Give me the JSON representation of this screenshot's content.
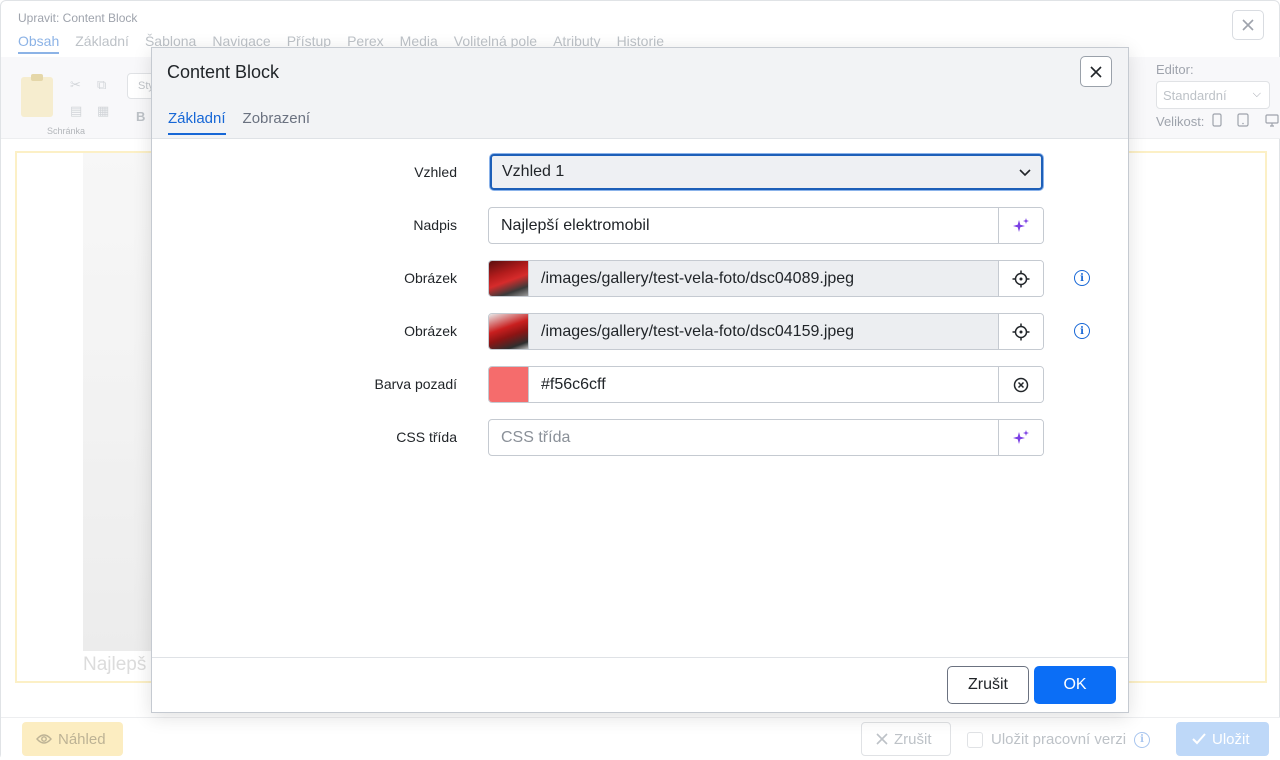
{
  "background": {
    "window_title": "Upravit: Content Block",
    "tabs": [
      "Obsah",
      "Základní",
      "Šablona",
      "Navigace",
      "Přístup",
      "Perex",
      "Media",
      "Volitelná pole",
      "Atributy",
      "Historie"
    ],
    "toolbar": {
      "clipboard_label": "Schránka",
      "style_placeholder": "Sty",
      "bold_label": "B",
      "editor_label": "Editor:",
      "editor_value": "Standardní",
      "size_label": "Velikost:"
    },
    "content_text": "Najlepš",
    "footer": {
      "preview_label": "Náhled",
      "cancel_label": "Zrušit",
      "save_draft_label": "Uložit pracovní verzi",
      "save_label": "Uložit"
    }
  },
  "modal": {
    "title": "Content Block",
    "tabs": [
      {
        "label": "Základní",
        "active": true
      },
      {
        "label": "Zobrazení",
        "active": false
      }
    ],
    "fields": {
      "appearance": {
        "label": "Vzhled",
        "value": "Vzhled 1"
      },
      "heading": {
        "label": "Nadpis",
        "value": "Najlepší elektromobil"
      },
      "image1": {
        "label": "Obrázek",
        "value": "/images/gallery/test-vela-foto/dsc04089.jpeg"
      },
      "image2": {
        "label": "Obrázek",
        "value": "/images/gallery/test-vela-foto/dsc04159.jpeg"
      },
      "bg_color": {
        "label": "Barva pozadí",
        "value": "#f56c6cff",
        "swatch": "#f56c6c"
      },
      "css_class": {
        "label": "CSS třída",
        "placeholder": "CSS třída"
      }
    },
    "footer": {
      "cancel_label": "Zrušit",
      "ok_label": "OK"
    }
  },
  "colors": {
    "accent": "#1767d6",
    "primary_button": "#0b6ef6",
    "ai_icon": "#7b3fe4"
  }
}
